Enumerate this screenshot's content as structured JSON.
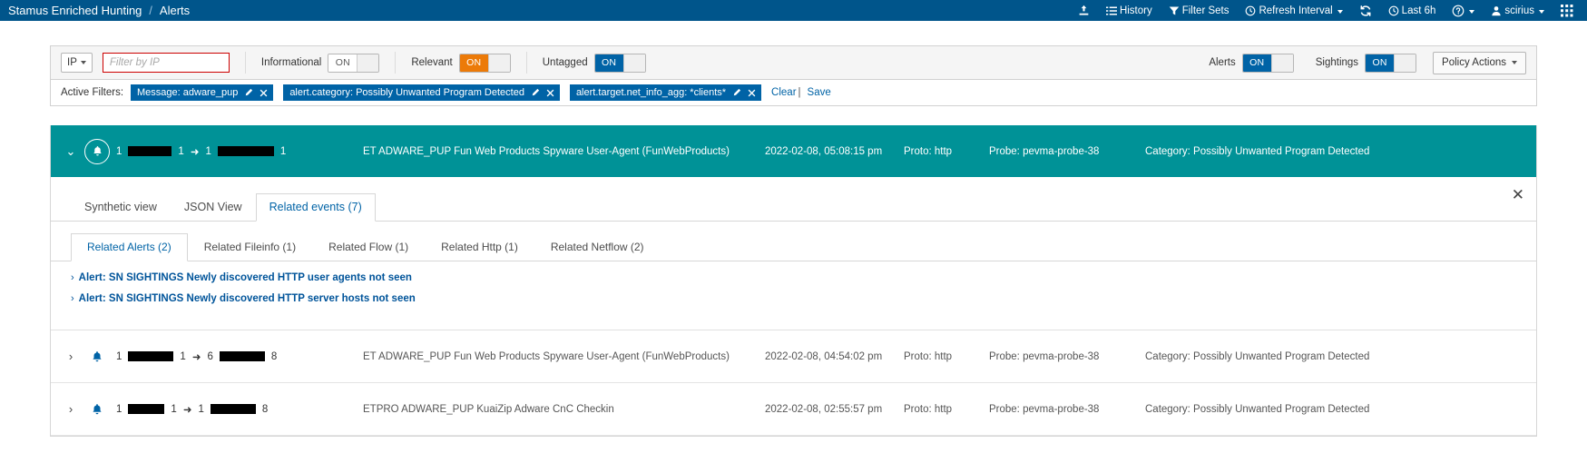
{
  "topnav": {
    "brand": "Stamus Enriched Hunting",
    "separator": "/",
    "current": "Alerts",
    "items": [
      {
        "id": "upload",
        "label": "",
        "icon": "upload-icon",
        "caret": false
      },
      {
        "id": "history",
        "label": "History",
        "icon": "list-icon",
        "caret": false
      },
      {
        "id": "filtersets",
        "label": "Filter Sets",
        "icon": "funnel-icon",
        "caret": false
      },
      {
        "id": "refresh_interval",
        "label": "Refresh Interval",
        "icon": "clock-icon",
        "caret": true
      },
      {
        "id": "reload",
        "label": "",
        "icon": "refresh-icon",
        "caret": false
      },
      {
        "id": "timerange",
        "label": "Last 6h",
        "icon": "clock-icon",
        "caret": false
      },
      {
        "id": "help",
        "label": "",
        "icon": "question-circle-icon",
        "caret": true
      },
      {
        "id": "user",
        "label": "scirius",
        "icon": "user-icon",
        "caret": true
      },
      {
        "id": "apps",
        "label": "",
        "icon": "grid-icon",
        "caret": false
      }
    ]
  },
  "toolbar": {
    "field_select": "IP",
    "search_placeholder": "Filter by IP",
    "search_value": "",
    "toggles": [
      {
        "label": "Informational",
        "state": "ON",
        "style": "grey"
      },
      {
        "label": "Relevant",
        "state": "ON",
        "style": "orange"
      },
      {
        "label": "Untagged",
        "state": "ON",
        "style": "blue"
      }
    ],
    "right_toggles": [
      {
        "label": "Alerts",
        "state": "ON",
        "style": "blue"
      },
      {
        "label": "Sightings",
        "state": "ON",
        "style": "blue"
      }
    ],
    "policy_actions": "Policy Actions"
  },
  "active_filters": {
    "label": "Active Filters:",
    "chips": [
      {
        "text": "Message: adware_pup"
      },
      {
        "text": "alert.category: Possibly Unwanted Program Detected"
      },
      {
        "text": "alert.target.net_info_agg: *clients*"
      }
    ],
    "clear": "Clear",
    "separator": "|",
    "save": "Save"
  },
  "alerts": [
    {
      "selected": true,
      "src_prefix": "1",
      "src_suffix": "1",
      "src_w": 48,
      "dst_prefix": "1",
      "dst_suffix": "1",
      "dst_w": 62,
      "signature": "ET ADWARE_PUP Fun Web Products Spyware User-Agent (FunWebProducts)",
      "timestamp": "2022-02-08, 05:08:15 pm",
      "proto": "Proto: http",
      "probe": "Probe: pevma-probe-38",
      "category": "Category: Possibly Unwanted Program Detected"
    },
    {
      "selected": false,
      "src_prefix": "1",
      "src_suffix": "1",
      "src_w": 50,
      "dst_prefix": "6",
      "dst_suffix": "8",
      "dst_w": 50,
      "signature": "ET ADWARE_PUP Fun Web Products Spyware User-Agent (FunWebProducts)",
      "timestamp": "2022-02-08, 04:54:02 pm",
      "proto": "Proto: http",
      "probe": "Probe: pevma-probe-38",
      "category": "Category: Possibly Unwanted Program Detected"
    },
    {
      "selected": false,
      "src_prefix": "1",
      "src_suffix": "1",
      "src_w": 40,
      "dst_prefix": "1",
      "dst_suffix": "8",
      "dst_w": 50,
      "signature": "ETPRO ADWARE_PUP KuaiZip Adware CnC Checkin",
      "timestamp": "2022-02-08, 02:55:57 pm",
      "proto": "Proto: http",
      "probe": "Probe: pevma-probe-38",
      "category": "Category: Possibly Unwanted Program Detected"
    }
  ],
  "detail": {
    "close_label": "✕",
    "outer_tabs": [
      {
        "label": "Synthetic view",
        "active": false
      },
      {
        "label": "JSON View",
        "active": false
      },
      {
        "label": "Related events (7)",
        "active": true
      }
    ],
    "inner_tabs": [
      {
        "label": "Related Alerts (2)",
        "active": true
      },
      {
        "label": "Related Fileinfo (1)",
        "active": false
      },
      {
        "label": "Related Flow (1)",
        "active": false
      },
      {
        "label": "Related Http (1)",
        "active": false
      },
      {
        "label": "Related Netflow (2)",
        "active": false
      }
    ],
    "related_alerts": [
      {
        "caret": "›",
        "label": "Alert: SN SIGHTINGS Newly discovered HTTP user agents not seen"
      },
      {
        "caret": "›",
        "label": "Alert: SN SIGHTINGS Newly discovered HTTP server hosts not seen"
      }
    ]
  },
  "colors": {
    "nav_blue": "#00558b",
    "selected_teal": "#009297",
    "chip_blue": "#0063a6",
    "orange": "#ec7a08",
    "danger_red": "#cc0000"
  }
}
